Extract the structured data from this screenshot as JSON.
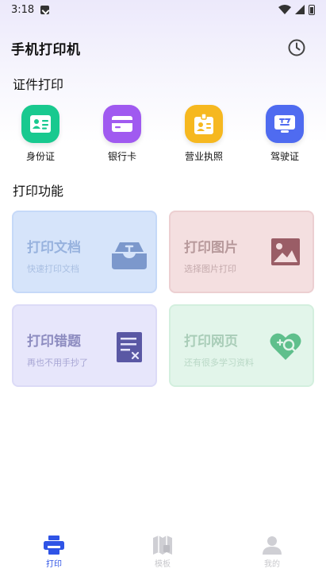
{
  "status_bar": {
    "time": "3:18"
  },
  "header": {
    "title": "手机打印机",
    "history_icon": "clock-icon"
  },
  "sections": {
    "id_print": "证件打印",
    "print_functions": "打印功能"
  },
  "id_items": [
    {
      "label": "身份证",
      "icon": "id-card-icon",
      "color": "#19c98f"
    },
    {
      "label": "银行卡",
      "icon": "bank-card-icon",
      "color": "#a05af0"
    },
    {
      "label": "营业执照",
      "icon": "license-icon",
      "color": "#f6b820"
    },
    {
      "label": "驾驶证",
      "icon": "driver-license-icon",
      "color": "#4f6bf0"
    }
  ],
  "cards": {
    "doc": {
      "title": "打印文档",
      "subtitle": "快速打印文档",
      "icon": "document-tray-icon"
    },
    "img": {
      "title": "打印图片",
      "subtitle": "选择图片打印",
      "icon": "image-icon"
    },
    "err": {
      "title": "打印错题",
      "subtitle": "再也不用手抄了",
      "icon": "wrong-question-icon"
    },
    "web": {
      "title": "打印网页",
      "subtitle": "还有很多学习资料",
      "icon": "web-search-icon"
    }
  },
  "bottom_nav": [
    {
      "label": "打印",
      "icon": "printer-icon",
      "active": true
    },
    {
      "label": "模板",
      "icon": "template-icon",
      "active": false
    },
    {
      "label": "我的",
      "icon": "profile-icon",
      "active": false
    }
  ],
  "colors": {
    "accent": "#2f54e6",
    "inactive": "#c8c8cc"
  }
}
